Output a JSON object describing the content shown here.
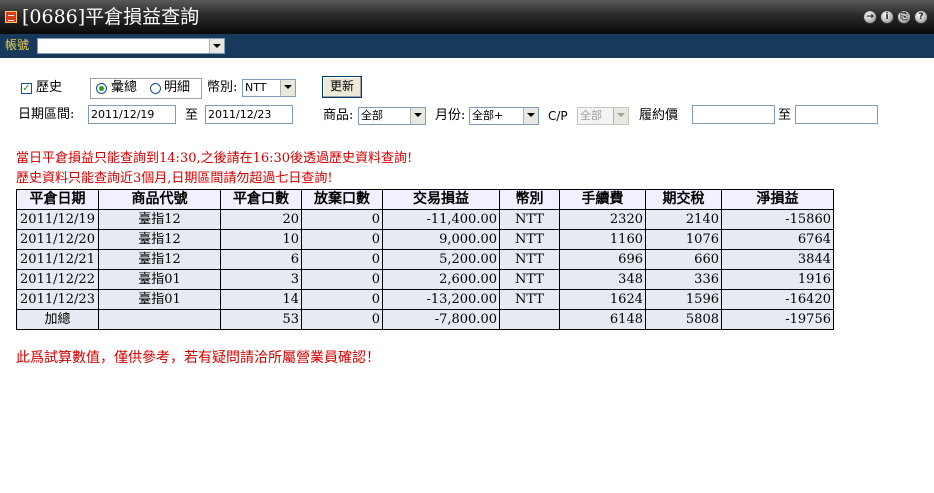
{
  "window": {
    "title": "[0686]平倉損益查詢",
    "buttons": [
      "→",
      "i",
      "⎘",
      "?"
    ]
  },
  "account": {
    "label": "帳號",
    "value": ""
  },
  "filters": {
    "history_label": "歷史",
    "history_checked": true,
    "summary_label": "彙總",
    "detail_label": "明細",
    "mode_selected": "summary",
    "currency_label": "幣別:",
    "currency_value": "NTT",
    "refresh_label": "更新",
    "date_range_label": "日期區間:",
    "date_from": "2011/12/19",
    "to_label": "至",
    "date_to": "2011/12/23",
    "product_label": "商品:",
    "product_value": "全部",
    "month_label": "月份:",
    "month_value": "全部+",
    "cp_label": "C/P",
    "cp_value": "全部",
    "strike_label": "履約價",
    "strike_from": "",
    "strike_to_label": "至",
    "strike_to": ""
  },
  "notices": [
    "當日平倉損益只能查詢到14:30,之後請在16:30後透過歷史資料查詢!",
    "歷史資料只能查詢近3個月,日期區間請勿超過七日查詢!"
  ],
  "table": {
    "columns": [
      "平倉日期",
      "商品代號",
      "平倉口數",
      "放棄口數",
      "交易損益",
      "幣別",
      "手續費",
      "期交稅",
      "淨損益"
    ],
    "rows": [
      [
        "2011/12/19",
        "臺指12",
        "20",
        "0",
        "-11,400.00",
        "NTT",
        "2320",
        "2140",
        "-15860"
      ],
      [
        "2011/12/20",
        "臺指12",
        "10",
        "0",
        "9,000.00",
        "NTT",
        "1160",
        "1076",
        "6764"
      ],
      [
        "2011/12/21",
        "臺指12",
        "6",
        "0",
        "5,200.00",
        "NTT",
        "696",
        "660",
        "3844"
      ],
      [
        "2011/12/22",
        "臺指01",
        "3",
        "0",
        "2,600.00",
        "NTT",
        "348",
        "336",
        "1916"
      ],
      [
        "2011/12/23",
        "臺指01",
        "14",
        "0",
        "-13,200.00",
        "NTT",
        "1624",
        "1596",
        "-16420"
      ]
    ],
    "total": [
      "加總",
      "",
      "53",
      "0",
      "-7,800.00",
      "",
      "6148",
      "5808",
      "-19756"
    ]
  },
  "footer_note": "此爲試算數值，僅供參考，若有疑問請洽所屬營業員確認！",
  "colors": {
    "title_bar": "#1a1a1a",
    "account_bar": "#173a5c",
    "account_label": "#f2d24a",
    "notice_red": "#d40000",
    "table_cell_bg": "#e6eaf2",
    "table_header_bg": "#f2f0ff"
  }
}
